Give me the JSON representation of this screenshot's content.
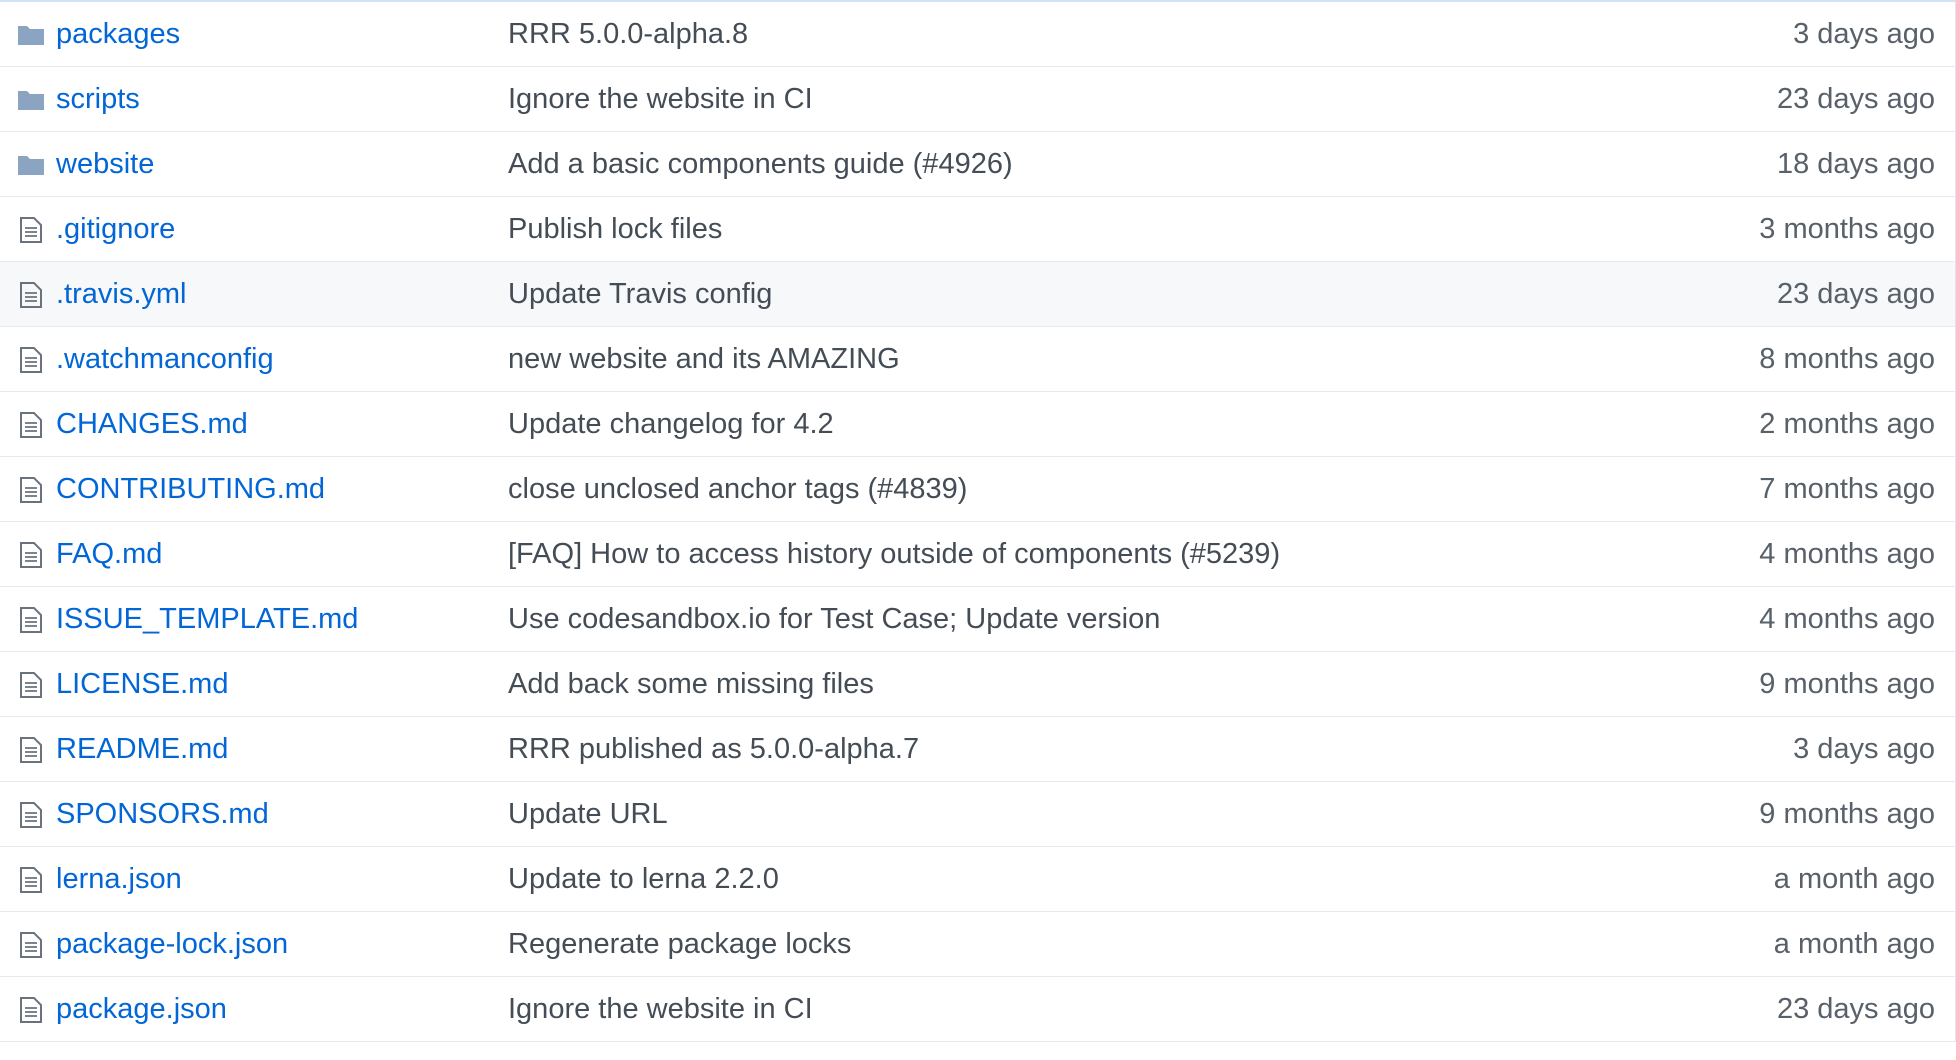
{
  "colors": {
    "link": "#0366d6",
    "message": "#444d56",
    "age": "#586069",
    "folder_icon": "#79b8ff",
    "file_icon": "#6a737d",
    "row_border": "#e8ebee",
    "row_highlight": "#f6f8fa"
  },
  "files": [
    {
      "type": "folder",
      "icon": "folder-icon",
      "name": "packages",
      "message": "RRR 5.0.0-alpha.8",
      "age": "3 days ago"
    },
    {
      "type": "folder",
      "icon": "folder-icon",
      "name": "scripts",
      "message": "Ignore the website in CI",
      "age": "23 days ago"
    },
    {
      "type": "folder",
      "icon": "folder-icon",
      "name": "website",
      "message": "Add a basic components guide (#4926)",
      "age": "18 days ago"
    },
    {
      "type": "file",
      "icon": "file-icon",
      "name": ".gitignore",
      "message": "Publish lock files",
      "age": "3 months ago"
    },
    {
      "type": "file",
      "icon": "file-icon",
      "name": ".travis.yml",
      "message": "Update Travis config",
      "age": "23 days ago"
    },
    {
      "type": "file",
      "icon": "file-icon",
      "name": ".watchmanconfig",
      "message": "new website and its AMAZING",
      "age": "8 months ago"
    },
    {
      "type": "file",
      "icon": "file-icon",
      "name": "CHANGES.md",
      "message": "Update changelog for 4.2",
      "age": "2 months ago"
    },
    {
      "type": "file",
      "icon": "file-icon",
      "name": "CONTRIBUTING.md",
      "message": "close unclosed anchor tags (#4839)",
      "age": "7 months ago"
    },
    {
      "type": "file",
      "icon": "file-icon",
      "name": "FAQ.md",
      "message": "[FAQ] How to access history outside of components (#5239)",
      "age": "4 months ago"
    },
    {
      "type": "file",
      "icon": "file-icon",
      "name": "ISSUE_TEMPLATE.md",
      "message": "Use codesandbox.io for Test Case; Update version",
      "age": "4 months ago"
    },
    {
      "type": "file",
      "icon": "file-icon",
      "name": "LICENSE.md",
      "message": "Add back some missing files",
      "age": "9 months ago"
    },
    {
      "type": "file",
      "icon": "file-icon",
      "name": "README.md",
      "message": "RRR published as 5.0.0-alpha.7",
      "age": "3 days ago"
    },
    {
      "type": "file",
      "icon": "file-icon",
      "name": "SPONSORS.md",
      "message": "Update URL",
      "age": "9 months ago"
    },
    {
      "type": "file",
      "icon": "file-icon",
      "name": "lerna.json",
      "message": "Update to lerna 2.2.0",
      "age": "a month ago"
    },
    {
      "type": "file",
      "icon": "file-icon",
      "name": "package-lock.json",
      "message": "Regenerate package locks",
      "age": "a month ago"
    },
    {
      "type": "file",
      "icon": "file-icon",
      "name": "package.json",
      "message": "Ignore the website in CI",
      "age": "23 days ago"
    }
  ]
}
